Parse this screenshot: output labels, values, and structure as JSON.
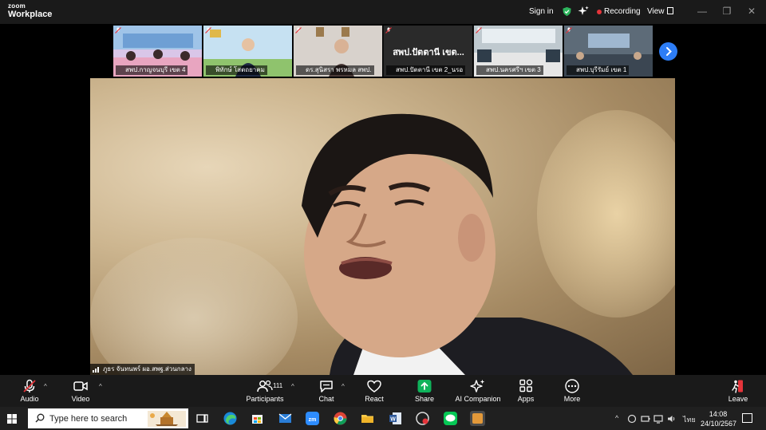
{
  "app": {
    "logo_line1": "zoom",
    "logo_line2": "Workplace"
  },
  "titlebar": {
    "sign_in": "Sign in",
    "recording": "Recording",
    "view": "View",
    "minimize": "—",
    "restore": "❐",
    "close": "✕"
  },
  "thumbnails": [
    {
      "name": "สพป.กาญจนบุรี เขต 4",
      "bg": "#d9c6e8"
    },
    {
      "name": "พิทักษ์ โสตถยาคม",
      "bg": "#b7d4ec"
    },
    {
      "name": "ดร.สุนิสรา พรหมล สพป.",
      "bg": "#cfc9c4"
    },
    {
      "name": "สพป.ปัตตานี เขต 2_นรอ",
      "bg": "#2a2a2a",
      "label": "สพป.ปัตตานี เขต..."
    },
    {
      "name": "สพป.นครศรีฯ เขต 3",
      "bg": "#8fa7b8"
    },
    {
      "name": "สพป.บุรีรัมย์ เขต 1",
      "bg": "#7a8795"
    }
  ],
  "main_video": {
    "speaker_name": "ภูธร จันทนพร์ ผอ.สพฐ.ส่วนกลาง"
  },
  "toolbar": {
    "audio": "Audio",
    "video": "Video",
    "participants": "Participants",
    "participants_count": "111",
    "chat": "Chat",
    "react": "React",
    "share": "Share",
    "ai_companion": "AI Companion",
    "apps": "Apps",
    "more": "More",
    "leave": "Leave"
  },
  "taskbar": {
    "search_placeholder": "Type here to search",
    "language": "ไทย",
    "time": "14:08",
    "date": "24/10/2567"
  },
  "colors": {
    "accent": "#2d7df6",
    "record": "#e5343a",
    "share": "#0fb35b",
    "leave": "#e5343a"
  }
}
